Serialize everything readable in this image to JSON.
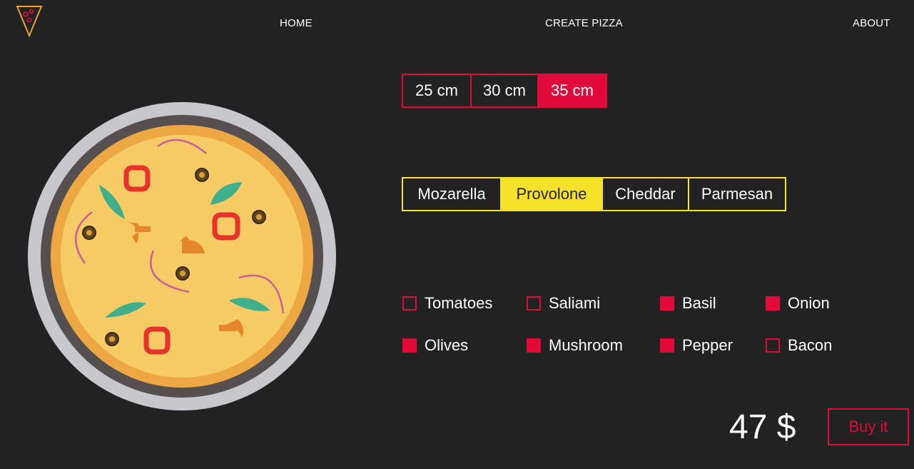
{
  "nav": {
    "home": "HOME",
    "create": "CREATE PIZZA",
    "about": "ABOUT"
  },
  "logo_icon": "pizza-slice-icon",
  "sizes": {
    "options": [
      "25 cm",
      "30 cm",
      "35 cm"
    ],
    "selected": "35 cm"
  },
  "cheeses": {
    "options": [
      "Mozarella",
      "Provolone",
      "Cheddar",
      "Parmesan"
    ],
    "selected": "Provolone"
  },
  "toppings": [
    {
      "label": "Tomatoes",
      "checked": false
    },
    {
      "label": "Saliami",
      "checked": false
    },
    {
      "label": "Basil",
      "checked": true
    },
    {
      "label": "Onion",
      "checked": true
    },
    {
      "label": "Olives",
      "checked": true
    },
    {
      "label": "Mushroom",
      "checked": true
    },
    {
      "label": "Pepper",
      "checked": true
    },
    {
      "label": "Bacon",
      "checked": false
    }
  ],
  "price": "47 $",
  "buy_label": "Buy it",
  "colors": {
    "background": "#222222",
    "accent_red": "#e20a3a",
    "accent_yellow": "#f7e22a"
  }
}
